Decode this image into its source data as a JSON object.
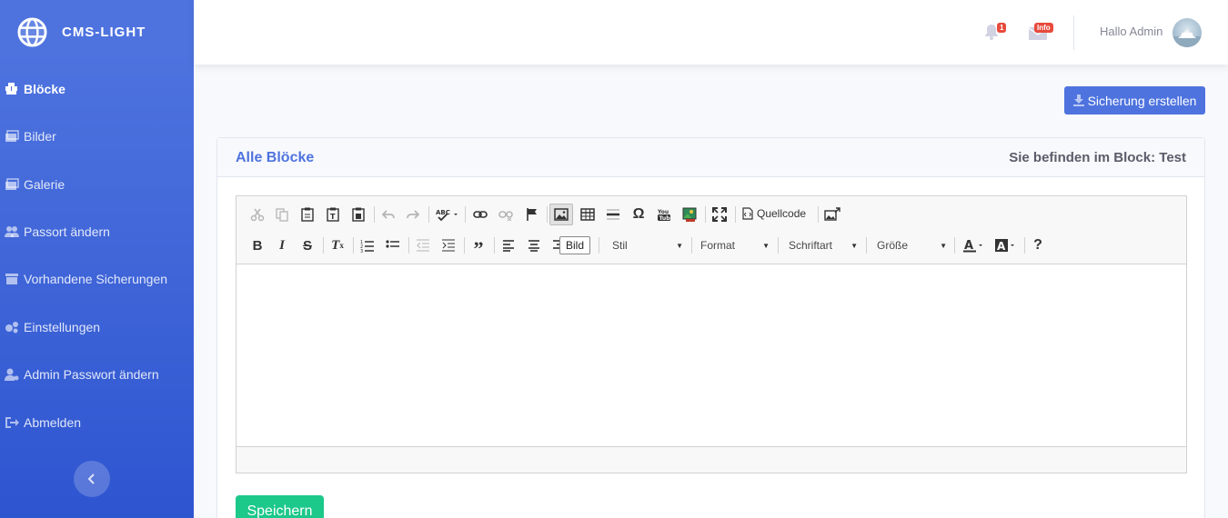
{
  "brand": {
    "name": "CMS-LIGHT"
  },
  "sidebar": {
    "items": [
      {
        "label": "Blöcke",
        "icon": "cubes-icon"
      },
      {
        "label": "Bilder",
        "icon": "images-icon"
      },
      {
        "label": "Galerie",
        "icon": "images-icon"
      },
      {
        "label": "Passort ändern",
        "icon": "users-icon"
      },
      {
        "label": "Vorhandene Sicherungen",
        "icon": "archive-icon"
      },
      {
        "label": "Einstellungen",
        "icon": "cogs-icon"
      },
      {
        "label": "Admin Passwort ändern",
        "icon": "user-cog-icon"
      },
      {
        "label": "Abmelden",
        "icon": "sign-out-icon"
      }
    ],
    "active_index": 0
  },
  "topbar": {
    "alerts_badge": "1",
    "messages_badge": "Info",
    "greeting": "Hallo Admin"
  },
  "actions": {
    "backup_label": "Sicherung erstellen"
  },
  "card": {
    "title": "Alle Blöcke",
    "location_prefix": "Sie befinden im Block:",
    "location_block": "Test"
  },
  "editor": {
    "source_label": "Quellcode",
    "tooltip": "Bild",
    "combos": {
      "style": "Stil",
      "format": "Format",
      "font": "Schriftart",
      "size": "Größe"
    },
    "content": ""
  },
  "save_label": "Speichern",
  "colors": {
    "primary": "#4e73df",
    "success": "#1cc88a",
    "danger": "#e74a3b"
  }
}
